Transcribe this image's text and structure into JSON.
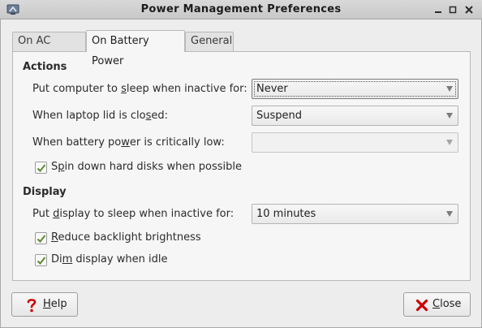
{
  "window": {
    "title": "Power Management Preferences"
  },
  "tabs": [
    {
      "label": "On AC Power",
      "active": false
    },
    {
      "label": "On Battery Power",
      "active": true
    },
    {
      "label": "General",
      "active": false
    }
  ],
  "actions": {
    "heading": "Actions",
    "sleep": {
      "label_pre": "Put computer to ",
      "label_u": "s",
      "label_post": "leep when inactive for:",
      "value": "Never"
    },
    "lid": {
      "label_pre": "When laptop lid is clo",
      "label_u": "s",
      "label_post": "ed:",
      "value": "Suspend"
    },
    "battery": {
      "label_pre": "When battery po",
      "label_u": "w",
      "label_post": "er is critically low:",
      "value": ""
    },
    "spin_down": {
      "label_pre": "S",
      "label_u": "p",
      "label_post": "in down hard disks when possible",
      "checked": true
    }
  },
  "display": {
    "heading": "Display",
    "sleep": {
      "label_pre": "Put ",
      "label_u": "d",
      "label_post": "isplay to sleep when inactive for:",
      "value": "10 minutes"
    },
    "backlight": {
      "label_pre": "",
      "label_u": "R",
      "label_post": "educe backlight brightness",
      "checked": true
    },
    "dim": {
      "label_pre": "Di",
      "label_u": "m",
      "label_post": " display when idle",
      "checked": true
    }
  },
  "buttons": {
    "help": {
      "label_u": "H",
      "label_post": "elp",
      "icon": "help-icon"
    },
    "close": {
      "label_u": "C",
      "label_post": "lose",
      "icon": "close-icon"
    }
  },
  "colors": {
    "check": "#5a8a2e",
    "help_icon": "#cc0000",
    "close_icon": "#cc0000"
  }
}
